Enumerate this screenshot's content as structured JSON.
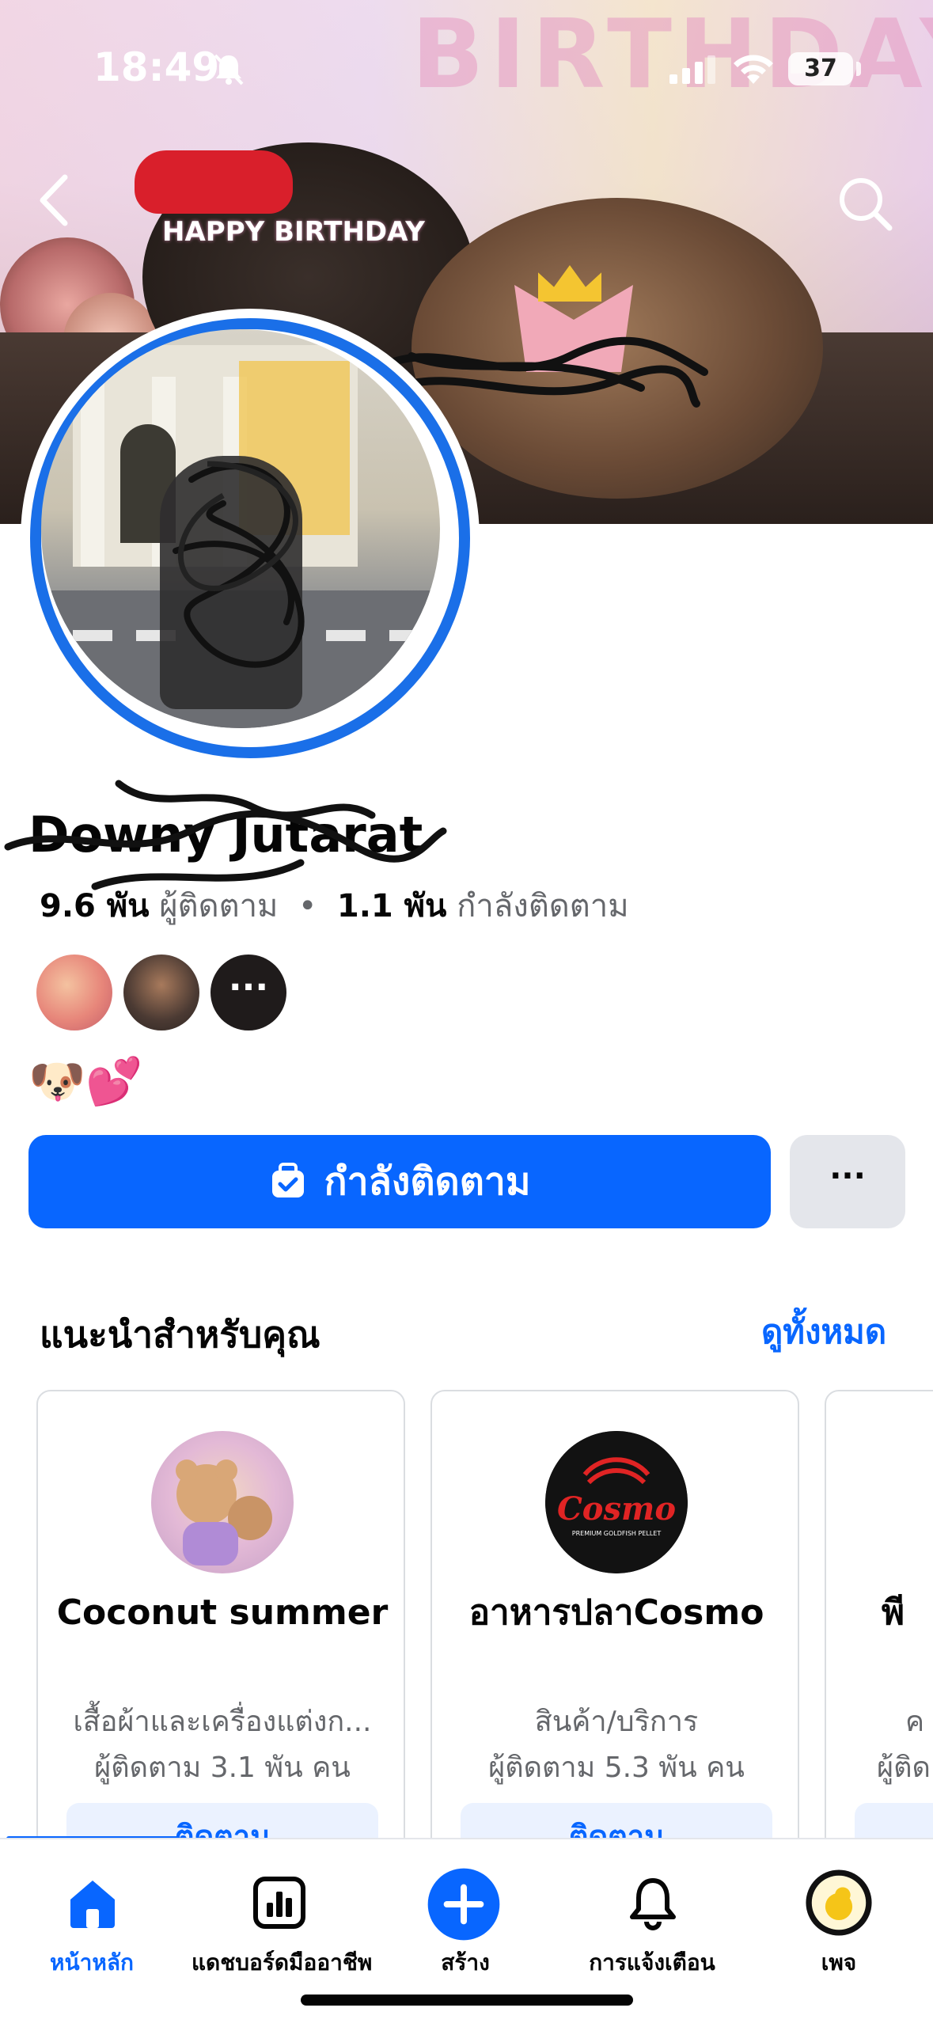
{
  "status_bar": {
    "time": "18:49",
    "battery": "37"
  },
  "cover": {
    "banner_text": "BIRTHDAY",
    "cake_topper": "HAPPY BIRTHDAY"
  },
  "profile": {
    "name": "Downy Jutarat",
    "followers_count": "9.6 พัน",
    "followers_label": "ผู้ติดตาม",
    "separator": "•",
    "following_count": "1.1 พัน",
    "following_label": "กำลังติดตาม",
    "more_friends": "···",
    "bio": "🐶💕"
  },
  "actions": {
    "follow_label": "กำลังติดตาม",
    "more_label": "···"
  },
  "suggestions": {
    "title": "แนะนำสำหรับคุณ",
    "see_all": "ดูทั้งหมด",
    "cards": [
      {
        "title": "Coconut summer",
        "category": "เสื้อผ้าและเครื่องแต่งก...",
        "followers": "ผู้ติดตาม 3.1 พัน คน",
        "cta": "ติดตาม"
      },
      {
        "title": "อาหารปลาCosmo",
        "category": "สินค้า/บริการ",
        "followers": "ผู้ติดตาม 5.3 พัน คน",
        "cta": "ติดตาม",
        "logo_text": "Cosmo",
        "logo_subtext": "PREMIUM GOLDFISH PELLET"
      },
      {
        "title": "พี",
        "category": "ค",
        "followers": "ผู้ติด",
        "cta": ""
      }
    ]
  },
  "tabbar": {
    "items": [
      {
        "label": "หน้าหลัก",
        "icon": "home-icon",
        "active": true
      },
      {
        "label": "แดชบอร์ดมืออาชีพ",
        "icon": "dashboard-icon",
        "active": false
      },
      {
        "label": "สร้าง",
        "icon": "create-plus-icon",
        "active": false
      },
      {
        "label": "การแจ้งเตือน",
        "icon": "bell-icon",
        "active": false
      },
      {
        "label": "เพจ",
        "icon": "page-avatar-icon",
        "active": false
      }
    ]
  },
  "colors": {
    "accent": "#0866ff",
    "ring": "#1a6fe8",
    "secondary_text": "#65676b",
    "button_gray": "#e4e6eb"
  }
}
